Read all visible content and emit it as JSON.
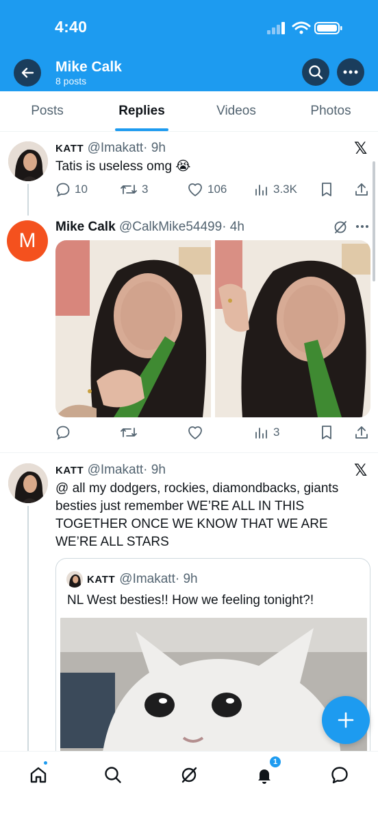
{
  "status_bar": {
    "time": "4:40"
  },
  "profile_header": {
    "name": "Mike Calk",
    "posts_count": "8 posts"
  },
  "tabs": [
    {
      "label": "Posts",
      "active": false
    },
    {
      "label": "Replies",
      "active": true
    },
    {
      "label": "Videos",
      "active": false
    },
    {
      "label": "Photos",
      "active": false
    }
  ],
  "tweets": [
    {
      "display_name": "KATT",
      "handle": "@Imakatt",
      "time": "· 9h",
      "text": "Tatis is useless omg 😭",
      "source_icon": "x-logo",
      "stats": {
        "replies": "10",
        "reposts": "3",
        "likes": "106",
        "views": "3.3K"
      }
    },
    {
      "display_name": "Mike Calk",
      "handle": "@CalkMike54499",
      "time": "· 4h",
      "avatar_letter": "M",
      "avatar_color": "#f4511e",
      "media": [
        "photo-1",
        "photo-2"
      ],
      "stats": {
        "replies": "",
        "reposts": "",
        "likes": "",
        "views": "3"
      }
    },
    {
      "display_name": "KATT",
      "handle": "@Imakatt",
      "time": "· 9h",
      "text": "@ all my dodgers, rockies, diamondbacks, giants besties just remember WE’RE ALL IN THIS TOGETHER ONCE WE KNOW THAT WE ARE WE’RE ALL STARS",
      "source_icon": "x-logo",
      "quote": {
        "display_name": "KATT",
        "handle": "@Imakatt",
        "time": "· 9h",
        "text": "NL West besties!! How we feeling tonight?!"
      }
    }
  ],
  "bottom_nav": {
    "items": [
      "home-icon",
      "search-icon",
      "grok-icon",
      "notifications-icon",
      "messages-icon"
    ],
    "notifications_badge": "1"
  },
  "colors": {
    "brand": "#1d9bf0",
    "header_button": "#1a3d5c",
    "avatar_m": "#f4511e"
  }
}
